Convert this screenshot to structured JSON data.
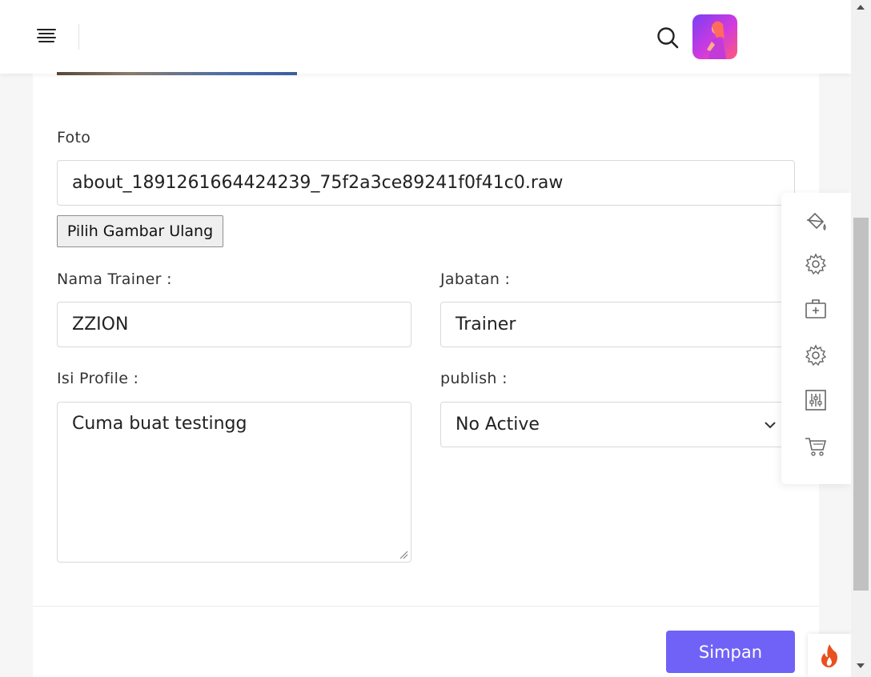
{
  "header": {
    "menu_icon": "hamburger-menu-icon",
    "search_icon": "search-icon",
    "avatar": "user-avatar"
  },
  "form": {
    "foto_label": "Foto",
    "foto_value": "about_1891261664424239_75f2a3ce89241f0f41c0.raw",
    "file_button": "Pilih Gambar Ulang",
    "nama_label": "Nama Trainer :",
    "nama_value": "ZZION",
    "jabatan_label": "Jabatan :",
    "jabatan_value": "Trainer",
    "profile_label": "Isi Profile :",
    "profile_value": "Cuma buat testingg",
    "publish_label": "publish :",
    "publish_value": "No Active",
    "save_button": "Simpan"
  },
  "tools": [
    "paint-bucket-icon",
    "gear-icon",
    "medical-case-icon",
    "gear-icon",
    "sliders-icon",
    "cart-icon"
  ],
  "colors": {
    "accent": "#7062f6",
    "fire": "#e8501e"
  }
}
